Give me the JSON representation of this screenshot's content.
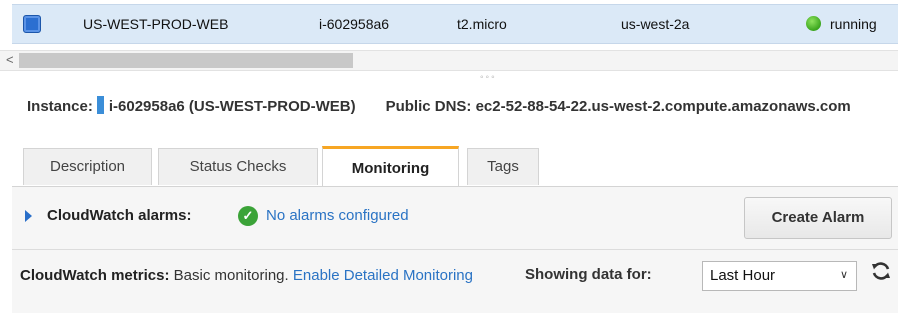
{
  "instance_row": {
    "name": "US-WEST-PROD-WEB",
    "instance_id": "i-602958a6",
    "instance_type": "t2.micro",
    "availability_zone": "us-west-2a",
    "state": "running"
  },
  "scrollbar": {
    "left_arrow": "<"
  },
  "resize_grip": "◦◦◦",
  "instance_header": {
    "instance_label": "Instance:",
    "instance_value": "i-602958a6 (US-WEST-PROD-WEB)",
    "dns_label": "Public DNS:",
    "dns_value": "ec2-52-88-54-22.us-west-2.compute.amazonaws.com"
  },
  "tabs": [
    {
      "label": "Description"
    },
    {
      "label": "Status Checks"
    },
    {
      "label": "Monitoring"
    },
    {
      "label": "Tags"
    }
  ],
  "alarms": {
    "label": "CloudWatch alarms:",
    "status": "No alarms configured",
    "create_button": "Create Alarm"
  },
  "metrics": {
    "label": "CloudWatch metrics:",
    "text": "Basic monitoring.",
    "link": "Enable Detailed Monitoring",
    "showing_label": "Showing data for:",
    "range_value": "Last Hour"
  },
  "colors": {
    "accent": "#f7a623",
    "link": "#2a73c4",
    "selected_row": "#dbe9f7",
    "running_green": "#3aa51d"
  }
}
